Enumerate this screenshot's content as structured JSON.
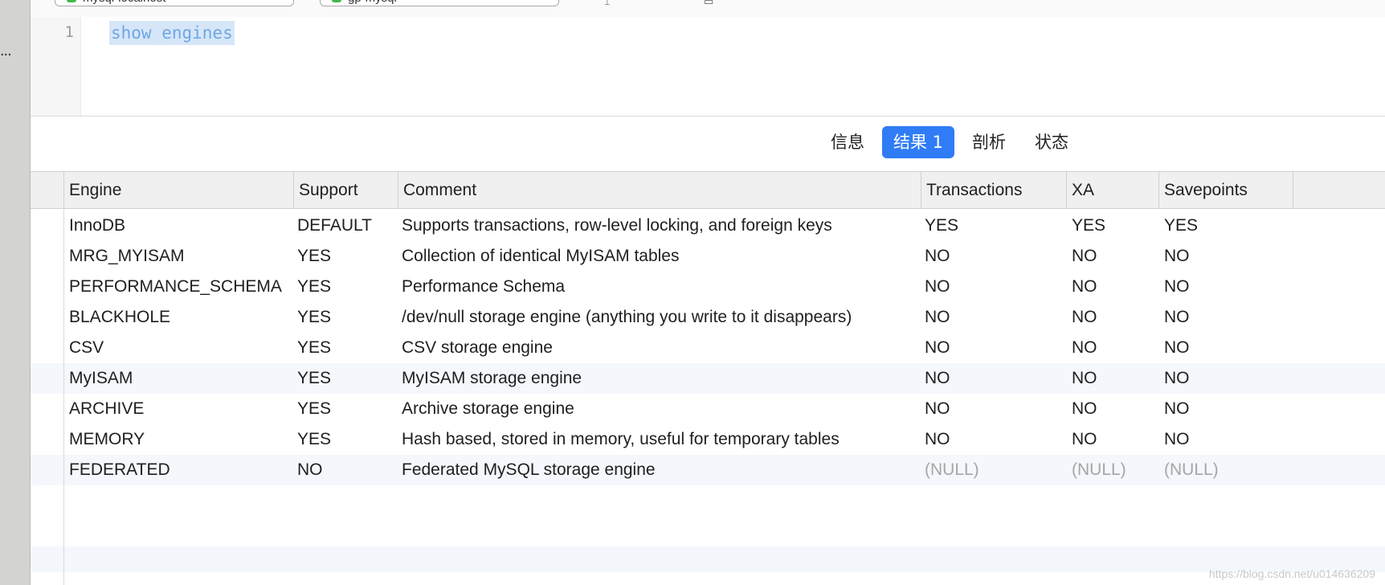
{
  "toolbar": {
    "field1_text": "mysql-localhost",
    "field2_text": "gp-mysql"
  },
  "editor": {
    "line_number": "1",
    "sql": "show engines"
  },
  "tabs": [
    {
      "label": "信息",
      "active": false
    },
    {
      "label": "结果 1",
      "active": true
    },
    {
      "label": "剖析",
      "active": false
    },
    {
      "label": "状态",
      "active": false
    }
  ],
  "sidebar": {
    "ellipsis": "..."
  },
  "table": {
    "columns": [
      "Engine",
      "Support",
      "Comment",
      "Transactions",
      "XA",
      "Savepoints"
    ],
    "rows": [
      [
        "InnoDB",
        "DEFAULT",
        "Supports transactions, row-level locking, and foreign keys",
        "YES",
        "YES",
        "YES"
      ],
      [
        "MRG_MYISAM",
        "YES",
        "Collection of identical MyISAM tables",
        "NO",
        "NO",
        "NO"
      ],
      [
        "PERFORMANCE_SCHEMA",
        "YES",
        "Performance Schema",
        "NO",
        "NO",
        "NO"
      ],
      [
        "BLACKHOLE",
        "YES",
        "/dev/null storage engine (anything you write to it disappears)",
        "NO",
        "NO",
        "NO"
      ],
      [
        "CSV",
        "YES",
        "CSV storage engine",
        "NO",
        "NO",
        "NO"
      ],
      [
        "MyISAM",
        "YES",
        "MyISAM storage engine",
        "NO",
        "NO",
        "NO"
      ],
      [
        "ARCHIVE",
        "YES",
        "Archive storage engine",
        "NO",
        "NO",
        "NO"
      ],
      [
        "MEMORY",
        "YES",
        "Hash based, stored in memory, useful for temporary tables",
        "NO",
        "NO",
        "NO"
      ],
      [
        "FEDERATED",
        "NO",
        "Federated MySQL storage engine",
        "(NULL)",
        "(NULL)",
        "(NULL)"
      ]
    ]
  },
  "watermark": "https://blog.csdn.net/u014636209"
}
